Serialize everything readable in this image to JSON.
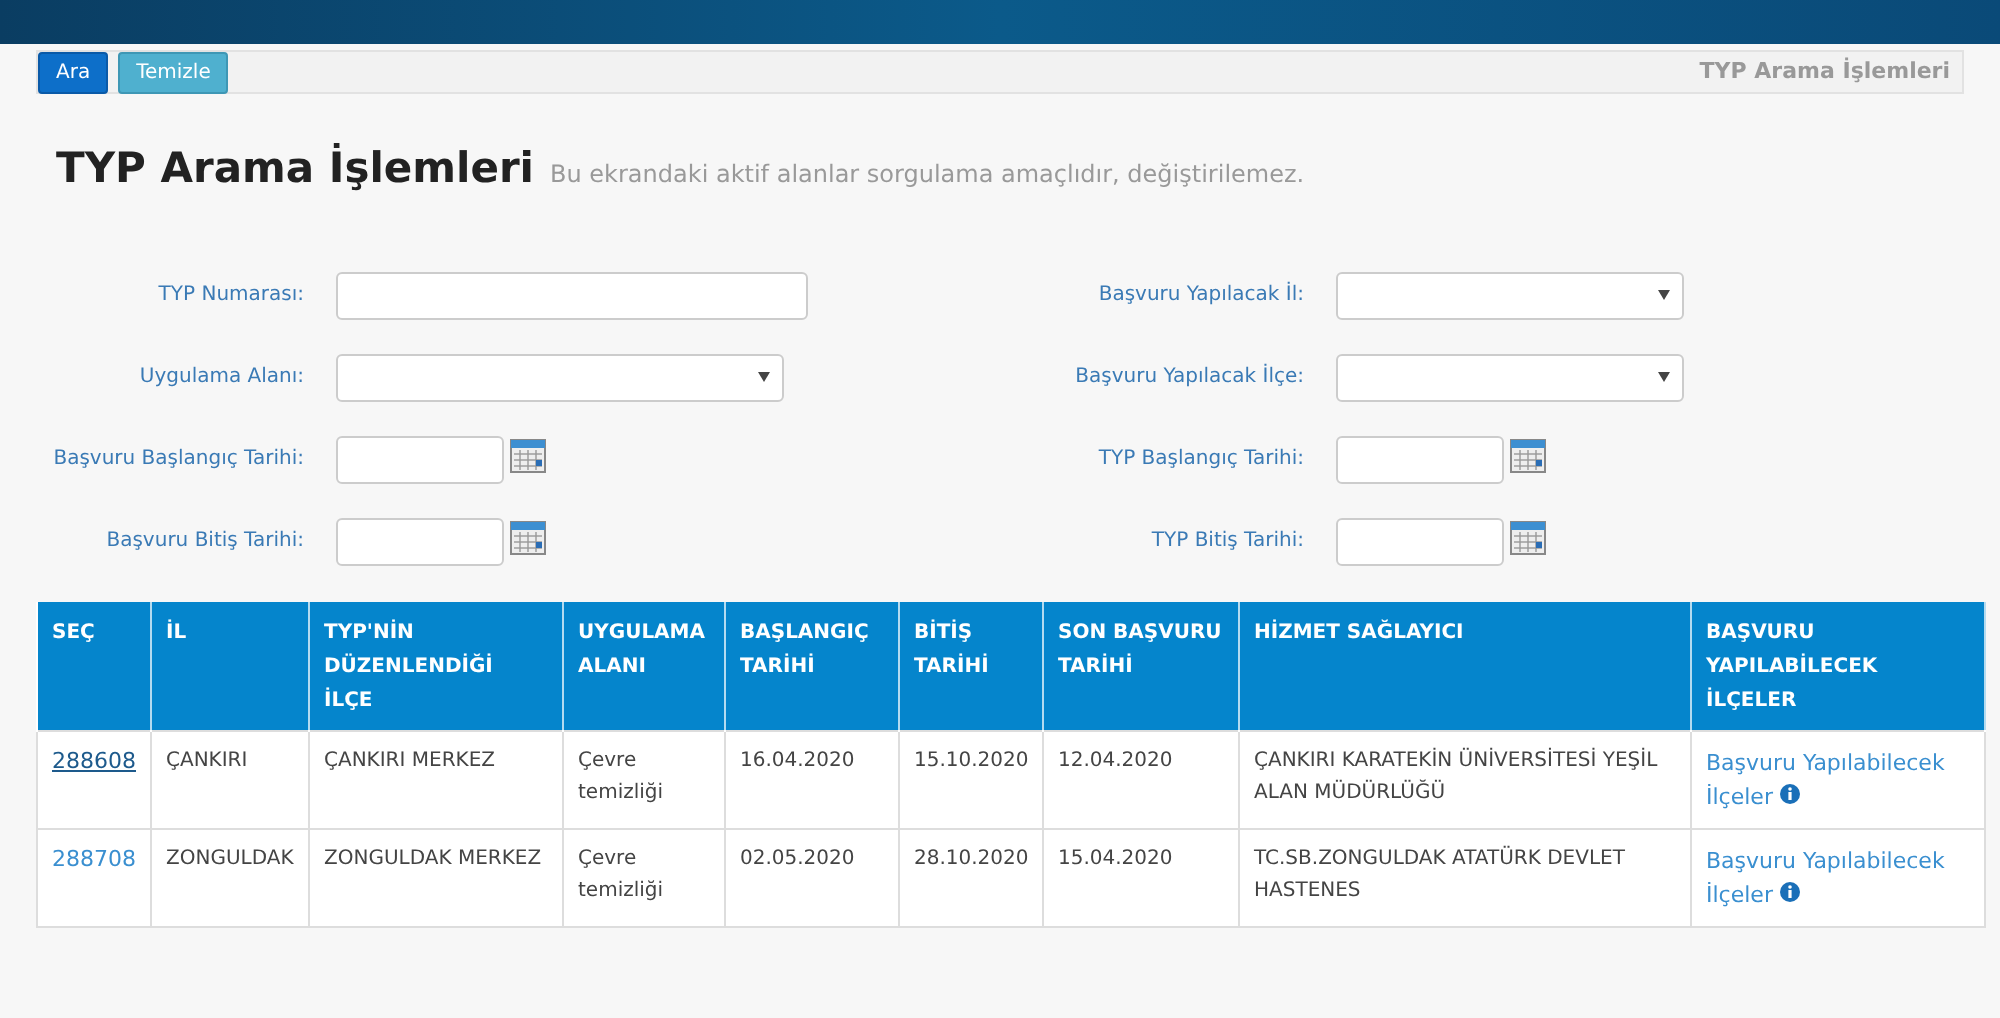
{
  "toolbar": {
    "buttons": [
      {
        "label": "Ara",
        "kind": "primary"
      },
      {
        "label": "Temizle",
        "kind": "info"
      }
    ],
    "breadcrumb": "TYP Arama İşlemleri"
  },
  "page": {
    "title": "TYP Arama İşlemleri",
    "subtitle": "Bu ekrandaki aktif alanlar sorgulama amaçlıdır, değiştirilemez."
  },
  "form": {
    "left": [
      {
        "label": "TYP Numarası:",
        "kind": "text"
      },
      {
        "label": "Uygulama Alanı:",
        "kind": "select"
      },
      {
        "label": "Başvuru Başlangıç Tarihi:",
        "kind": "date"
      },
      {
        "label": "Başvuru Bitiş Tarihi:",
        "kind": "date"
      }
    ],
    "right": [
      {
        "label": "Başvuru Yapılacak İl:",
        "kind": "select"
      },
      {
        "label": "Başvuru Yapılacak İlçe:",
        "kind": "select"
      },
      {
        "label": "TYP Başlangıç Tarihi:",
        "kind": "date"
      },
      {
        "label": "TYP Bitiş Tarihi:",
        "kind": "date"
      }
    ]
  },
  "table": {
    "columns": [
      "SEÇ",
      "İL",
      "TYP'NİN DÜZENLENDİĞİ İLÇE",
      "UYGULAMA ALANI",
      "BAŞLANGIÇ TARİHİ",
      "BİTİŞ TARİHİ",
      "SON BAŞVURU TARİHİ",
      "HİZMET SAĞLAYICI",
      "BAŞVURU YAPILABİLECEK İLÇELER"
    ],
    "rows": [
      {
        "id": "288608",
        "visited": true,
        "il": "ÇANKIRI",
        "ilce": "ÇANKIRI MERKEZ",
        "alan": "Çevre temizliği",
        "baslangic": "16.04.2020",
        "bitis": "15.10.2020",
        "son_basvuru": "12.04.2020",
        "saglayici": "ÇANKIRI KARATEKİN ÜNİVERSİTESİ YEŞİL ALAN MÜDÜRLÜĞÜ",
        "link": "Başvuru Yapılabilecek İlçeler"
      },
      {
        "id": "288708",
        "visited": false,
        "il": "ZONGULDAK",
        "ilce": "ZONGULDAK MERKEZ",
        "alan": "Çevre temizliği",
        "baslangic": "02.05.2020",
        "bitis": "28.10.2020",
        "son_basvuru": "15.04.2020",
        "saglayici": "TC.SB.ZONGULDAK ATATÜRK DEVLET HASTENES",
        "link": "Başvuru Yapılabilecek İlçeler"
      }
    ]
  }
}
